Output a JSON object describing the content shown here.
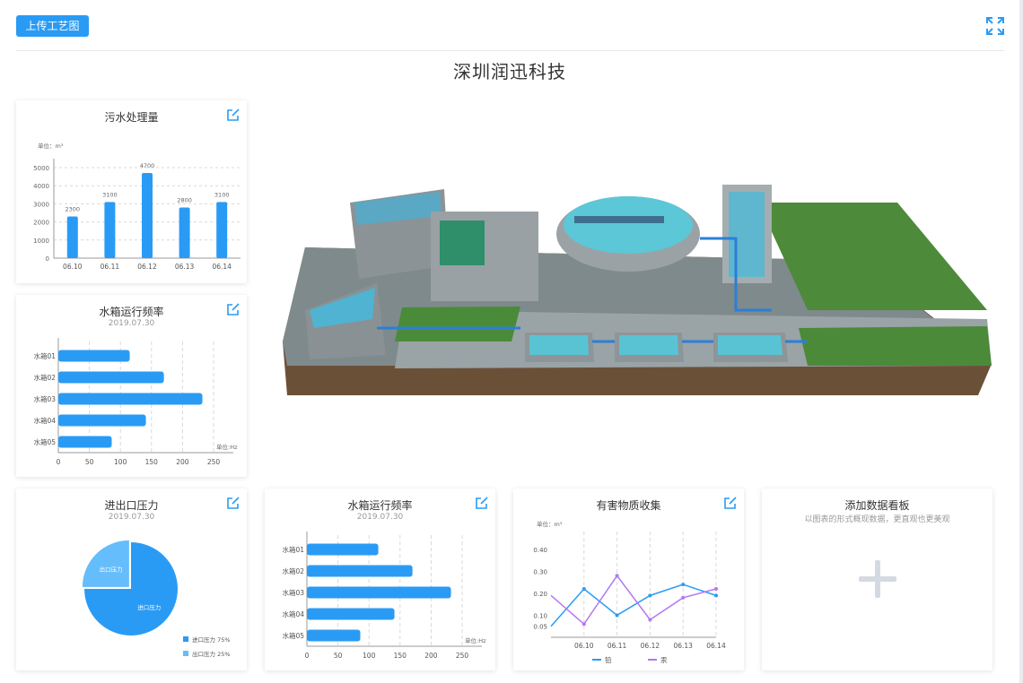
{
  "header": {
    "upload_label": "上传工艺图",
    "page_title": "深圳润迅科技"
  },
  "cards": {
    "sewage": {
      "title": "污水处理量",
      "unit": "单位：m³"
    },
    "tank_left": {
      "title": "水箱运行频率",
      "date": "2019.07.30",
      "unit": "单位:Hz"
    },
    "pressure": {
      "title": "进出口压力",
      "date": "2019.07.30"
    },
    "tank_mid": {
      "title": "水箱运行频率",
      "date": "2019.07.30",
      "unit": "单位:Hz"
    },
    "hazard": {
      "title": "有害物质收集",
      "unit": "单位：m³"
    },
    "add_board": {
      "title": "添加数据看板",
      "subtitle": "以图表的形式概现数据，更直观也更美观"
    }
  },
  "colors": {
    "accent": "#2a9bf5",
    "light_blue": "#65bdfb",
    "purple": "#b277f2"
  },
  "chart_data": [
    {
      "type": "bar",
      "title": "污水处理量",
      "ylabel": "单位：m³",
      "categories": [
        "06.10",
        "06.11",
        "06.12",
        "06.13",
        "06.14"
      ],
      "values": [
        2300,
        3100,
        4700,
        2800,
        3100
      ],
      "yticks": [
        0,
        1000,
        2000,
        3000,
        4000,
        5000
      ],
      "ylim": [
        0,
        5000
      ],
      "grid": true
    },
    {
      "type": "bar",
      "orientation": "horizontal",
      "title": "水箱运行频率",
      "subtitle": "2019.07.30",
      "xlabel": "单位:Hz",
      "categories": [
        "水箱01",
        "水箱02",
        "水箱03",
        "水箱04",
        "水箱05"
      ],
      "values": [
        115,
        170,
        232,
        141,
        86
      ],
      "xticks": [
        0,
        50,
        100,
        150,
        200,
        250
      ],
      "xlim": [
        0,
        250
      ],
      "grid": true
    },
    {
      "type": "pie",
      "title": "进出口压力",
      "subtitle": "2019.07.30",
      "slices": [
        {
          "name": "进口压力",
          "value": 75,
          "legend": "进口压力 75%"
        },
        {
          "name": "出口压力",
          "value": 25,
          "legend": "出口压力 25%"
        }
      ],
      "legend_position": "bottom-right"
    },
    {
      "type": "bar",
      "orientation": "horizontal",
      "title": "水箱运行频率",
      "subtitle": "2019.07.30",
      "xlabel": "单位:Hz",
      "categories": [
        "水箱01",
        "水箱02",
        "水箱03",
        "水箱04",
        "水箱05"
      ],
      "values": [
        115,
        170,
        232,
        141,
        86
      ],
      "xticks": [
        0,
        50,
        100,
        150,
        200,
        250
      ],
      "xlim": [
        0,
        250
      ],
      "grid": true
    },
    {
      "type": "line",
      "title": "有害物质收集",
      "ylabel": "单位：m³",
      "x": [
        "06.10",
        "06.11",
        "06.12",
        "06.13",
        "06.14"
      ],
      "series": [
        {
          "name": "铅",
          "values": [
            0.05,
            0.22,
            0.1,
            0.19,
            0.24,
            0.19
          ]
        },
        {
          "name": "汞",
          "values": [
            0.19,
            0.06,
            0.28,
            0.08,
            0.18,
            0.22
          ]
        }
      ],
      "yticks": [
        0.05,
        0.1,
        0.2,
        0.3,
        0.4
      ],
      "legend_position": "bottom",
      "grid": true
    }
  ]
}
